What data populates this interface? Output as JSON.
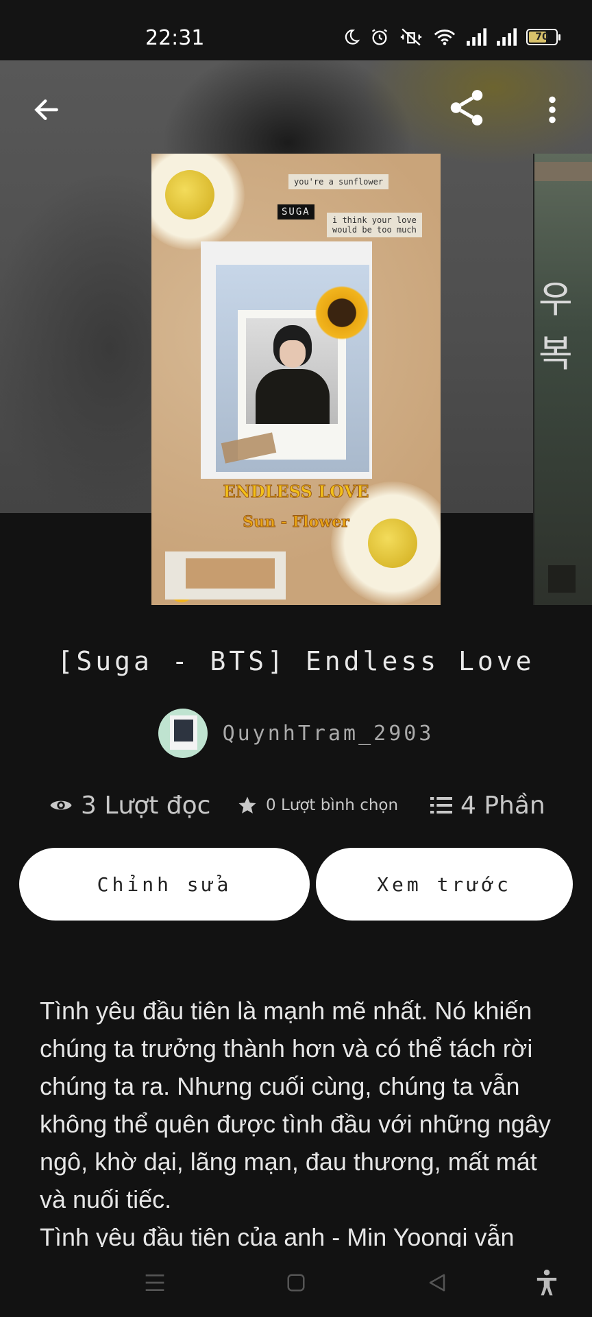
{
  "status_bar": {
    "time": "22:31",
    "battery": "70",
    "battery_level": 0.7,
    "icons": [
      "moon-icon",
      "alarm-icon",
      "vibrate-off-icon",
      "wifi-icon",
      "signal-icon",
      "signal-icon",
      "battery-icon"
    ]
  },
  "header": {
    "icons": [
      "back-arrow-icon",
      "share-icon",
      "more-vert-icon"
    ]
  },
  "cover": {
    "note_line1": "you're a sunflower",
    "tag": "SUGA",
    "note_line2": "i think your love",
    "note_line3": "would be too much",
    "title_line1": "ENDLESS LOVE",
    "title_line2": "Sun - Flower",
    "next_cover_glyph": "우복"
  },
  "story": {
    "title": "[Suga - BTS] Endless Love",
    "author": "QuynhTram_2903"
  },
  "stats": {
    "reads": "3 Lượt đọc",
    "votes": "0 Lượt bình chọn",
    "parts": "4 Phần"
  },
  "actions": {
    "edit": "Chỉnh sửa",
    "preview": "Xem trước"
  },
  "description": {
    "paragraph1": "Tình yêu đầu tiên là mạnh mẽ nhất. Nó khiến chúng ta trưởng thành hơn và có thể tách rời chúng ta ra. Nhưng cuối cùng, chúng ta vẫn không thể quên được tình đầu với những ngây ngô, khờ dại, lãng mạn, đau thương, mất mát và nuối tiếc.",
    "paragraph2": "Tình yêu đầu tiên của anh - Min Yoongi vẫn"
  },
  "nav_bar": {
    "icons": [
      "menu-icon",
      "home-square-icon",
      "back-triangle-icon",
      "accessibility-icon"
    ]
  },
  "colors": {
    "background": "#121212",
    "button": "#ffffff",
    "text": "#e6e6e6"
  }
}
